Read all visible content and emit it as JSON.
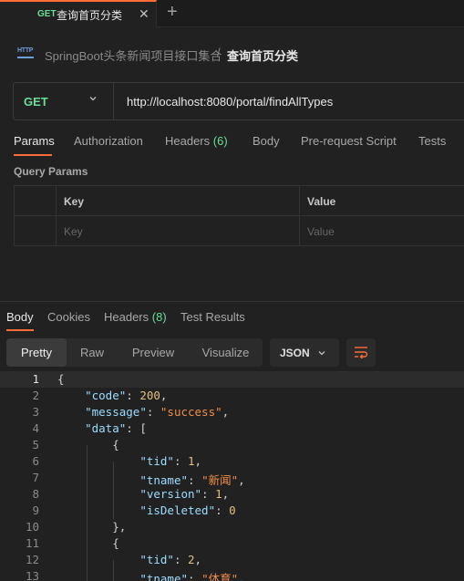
{
  "tab": {
    "method": "GET",
    "title": "查询首页分类",
    "close": "✕",
    "new_tab": "+"
  },
  "breadcrumb": {
    "icon": "HTTP",
    "parent": "SpringBoot头条新闻项目接口集合",
    "separator": "/",
    "current": "查询首页分类"
  },
  "request": {
    "method": "GET",
    "url": "http://localhost:8080/portal/findAllTypes"
  },
  "request_tabs": [
    {
      "label": "Params",
      "count": ""
    },
    {
      "label": "Authorization",
      "count": ""
    },
    {
      "label": "Headers",
      "count": "(6)"
    },
    {
      "label": "Body",
      "count": ""
    },
    {
      "label": "Pre-request Script",
      "count": ""
    },
    {
      "label": "Tests",
      "count": ""
    }
  ],
  "query_params": {
    "title": "Query Params",
    "headers": {
      "key": "Key",
      "value": "Value"
    },
    "placeholders": {
      "key": "Key",
      "value": "Value"
    }
  },
  "response_tabs": [
    {
      "label": "Body",
      "count": ""
    },
    {
      "label": "Cookies",
      "count": ""
    },
    {
      "label": "Headers",
      "count": "(8)"
    },
    {
      "label": "Test Results",
      "count": ""
    }
  ],
  "format_options": [
    "Pretty",
    "Raw",
    "Preview",
    "Visualize"
  ],
  "format_selected": "Pretty",
  "language": "JSON",
  "code_lines": [
    {
      "n": "1",
      "html": "<span class=\"p\">{</span>"
    },
    {
      "n": "2",
      "html": "    <span class=\"k\">\"code\"</span><span class=\"p\">: </span><span class=\"n\">200</span><span class=\"p\">,</span>"
    },
    {
      "n": "3",
      "html": "    <span class=\"k\">\"message\"</span><span class=\"p\">: </span><span class=\"s\">\"success\"</span><span class=\"p\">,</span>"
    },
    {
      "n": "4",
      "html": "    <span class=\"k\">\"data\"</span><span class=\"p\">: [</span>"
    },
    {
      "n": "5",
      "html": "        <span class=\"p\">{</span>"
    },
    {
      "n": "6",
      "html": "            <span class=\"k\">\"tid\"</span><span class=\"p\">: </span><span class=\"n\">1</span><span class=\"p\">,</span>"
    },
    {
      "n": "7",
      "html": "            <span class=\"k\">\"tname\"</span><span class=\"p\">: </span><span class=\"s\">\"新闻\"</span><span class=\"p\">,</span>"
    },
    {
      "n": "8",
      "html": "            <span class=\"k\">\"version\"</span><span class=\"p\">: </span><span class=\"n\">1</span><span class=\"p\">,</span>"
    },
    {
      "n": "9",
      "html": "            <span class=\"k\">\"isDeleted\"</span><span class=\"p\">: </span><span class=\"n\">0</span>"
    },
    {
      "n": "10",
      "html": "        <span class=\"p\">},</span>"
    },
    {
      "n": "11",
      "html": "        <span class=\"p\">{</span>"
    },
    {
      "n": "12",
      "html": "            <span class=\"k\">\"tid\"</span><span class=\"p\">: </span><span class=\"n\">2</span><span class=\"p\">,</span>"
    },
    {
      "n": "13",
      "html": "            <span class=\"k\">\"tname\"</span><span class=\"p\">: </span><span class=\"s\">\"体育\"</span><span class=\"p\">,</span>"
    }
  ],
  "colors": {
    "accent": "#ff6c37",
    "method_get": "#6bdd9a",
    "json_key": "#9cdcfe",
    "json_string": "#f08d49",
    "json_number": "#e0c080"
  }
}
